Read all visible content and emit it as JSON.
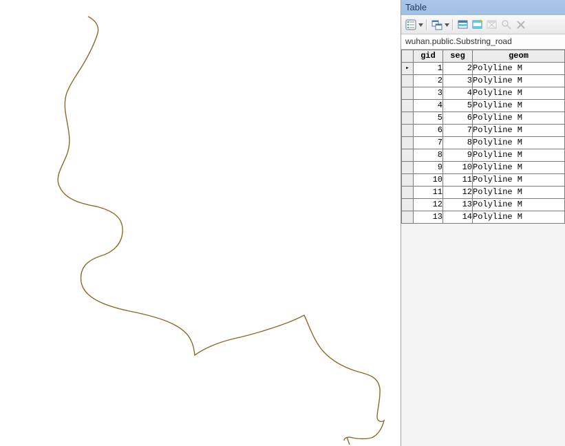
{
  "panel": {
    "title": "Table",
    "layer_name": "wuhan.public.Substring_road"
  },
  "toolbar": {
    "icons": {
      "options": "options-icon",
      "related": "related-tables-icon",
      "select_by_attr": "select-by-attributes-icon",
      "switch_selection": "switch-selection-icon",
      "clear_selection": "clear-selection-icon",
      "zoom_selected": "zoom-selected-icon",
      "close": "close-icon"
    }
  },
  "columns": {
    "gid": "gid",
    "seg": "seg",
    "geom": "geom"
  },
  "rows": [
    {
      "gid": "1",
      "seg": "2",
      "geom": "Polyline M"
    },
    {
      "gid": "2",
      "seg": "3",
      "geom": "Polyline M"
    },
    {
      "gid": "3",
      "seg": "4",
      "geom": "Polyline M"
    },
    {
      "gid": "4",
      "seg": "5",
      "geom": "Polyline M"
    },
    {
      "gid": "5",
      "seg": "6",
      "geom": "Polyline M"
    },
    {
      "gid": "6",
      "seg": "7",
      "geom": "Polyline M"
    },
    {
      "gid": "7",
      "seg": "8",
      "geom": "Polyline M"
    },
    {
      "gid": "8",
      "seg": "9",
      "geom": "Polyline M"
    },
    {
      "gid": "9",
      "seg": "10",
      "geom": "Polyline M"
    },
    {
      "gid": "10",
      "seg": "11",
      "geom": "Polyline M"
    },
    {
      "gid": "11",
      "seg": "12",
      "geom": "Polyline M"
    },
    {
      "gid": "12",
      "seg": "13",
      "geom": "Polyline M"
    },
    {
      "gid": "13",
      "seg": "14",
      "geom": "Polyline M"
    }
  ],
  "chart_data": {
    "type": "table",
    "title": "wuhan.public.Substring_road",
    "columns": [
      "gid",
      "seg",
      "geom"
    ],
    "rows": [
      [
        1,
        2,
        "Polyline M"
      ],
      [
        2,
        3,
        "Polyline M"
      ],
      [
        3,
        4,
        "Polyline M"
      ],
      [
        4,
        5,
        "Polyline M"
      ],
      [
        5,
        6,
        "Polyline M"
      ],
      [
        6,
        7,
        "Polyline M"
      ],
      [
        7,
        8,
        "Polyline M"
      ],
      [
        8,
        9,
        "Polyline M"
      ],
      [
        9,
        10,
        "Polyline M"
      ],
      [
        10,
        11,
        "Polyline M"
      ],
      [
        11,
        12,
        "Polyline M"
      ],
      [
        12,
        13,
        "Polyline M"
      ],
      [
        13,
        14,
        "Polyline M"
      ]
    ]
  }
}
